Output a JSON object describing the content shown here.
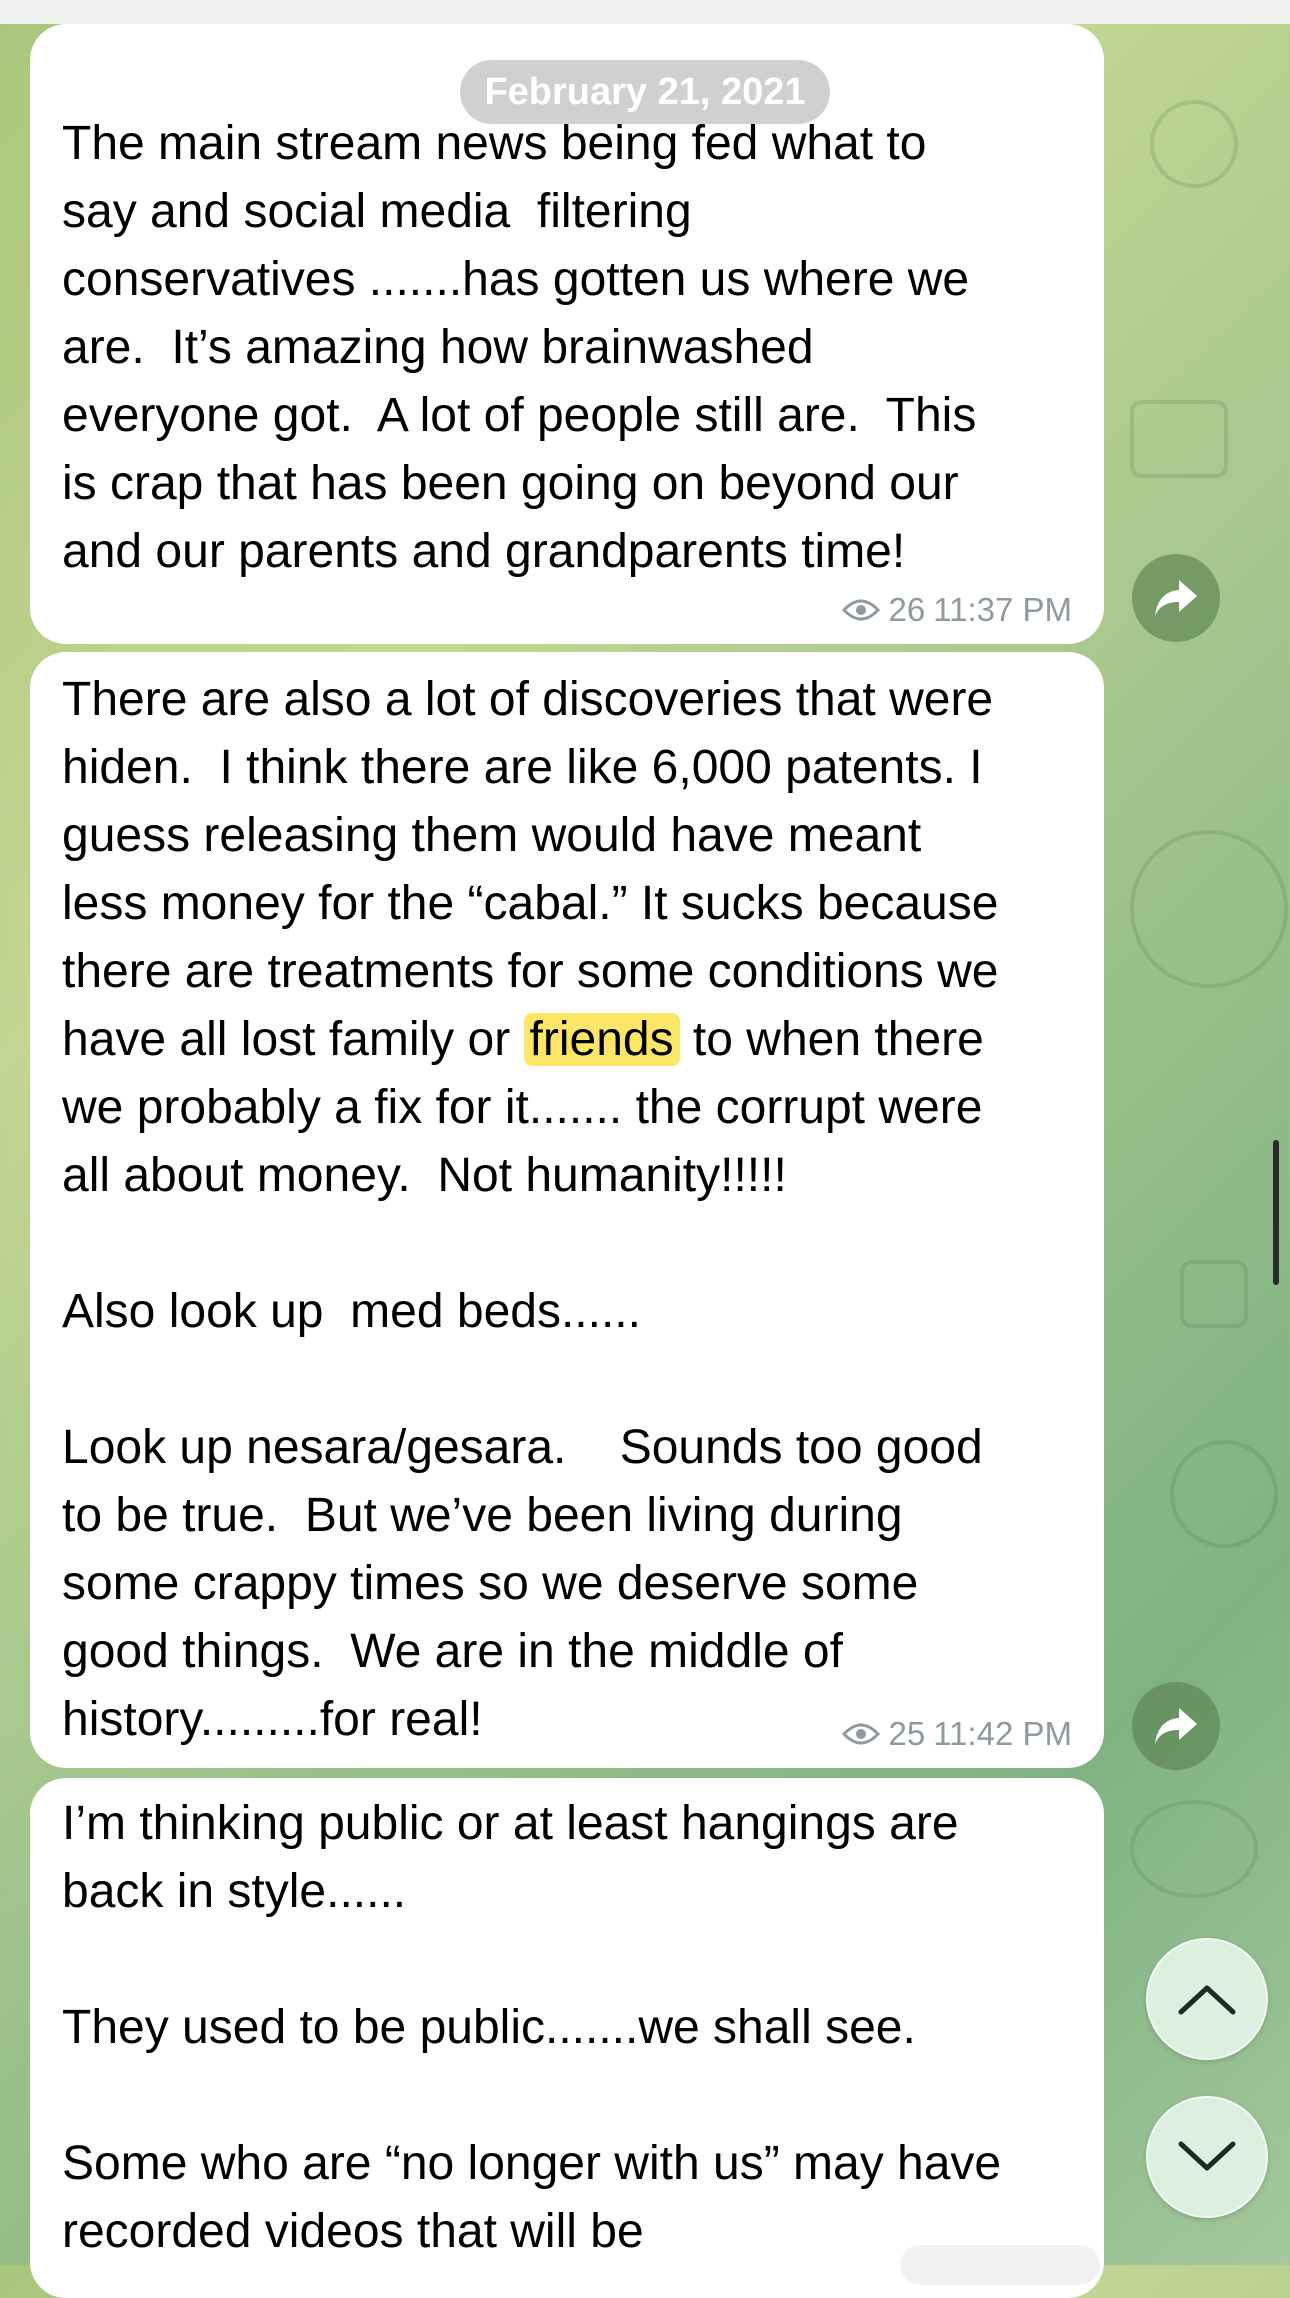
{
  "date_header": "February 21, 2021",
  "messages": [
    {
      "text": "The main stream news being fed what to\nsay and social media  filtering\nconservatives .......has gotten us where we\nare.  It’s amazing how brainwashed\neveryone got.  A lot of people still are.  This\nis crap that has been going on beyond our\nand our parents and grandparents time!",
      "views": "26",
      "time": "11:37 PM"
    },
    {
      "text_before": "There are also a lot of discoveries that were\nhiden.  I think there are like 6,000 patents. I\nguess releasing them would have meant\nless money for the “cabal.” It sucks because\nthere are treatments for some conditions we\nhave all lost family or ",
      "highlight": "friends",
      "text_after": " to when there\nwe probably a fix for it....... the corrupt were\nall about money.  Not humanity!!!!!\n\nAlso look up  med beds......\n\nLook up nesara/gesara.    Sounds too good\nto be true.  But we’ve been living during\nsome crappy times so we deserve some\ngood things.  We are in the middle of\nhistory.........for real!",
      "views": "25",
      "time": "11:42 PM"
    },
    {
      "text": "I’m thinking public or at least hangings are\nback in style......\n\nThey used to be public.......we shall see.\n\nSome who are “no longer with us” may have\nrecorded videos that will be"
    }
  ],
  "icons": {
    "forward": "forward-arrow-icon",
    "views": "eye-icon",
    "scroll_up": "chevron-up-icon",
    "scroll_down": "chevron-down-icon"
  },
  "colors": {
    "highlight": "#fbe667",
    "bubble": "#ffffff",
    "meta_text": "#8e9aa0"
  }
}
